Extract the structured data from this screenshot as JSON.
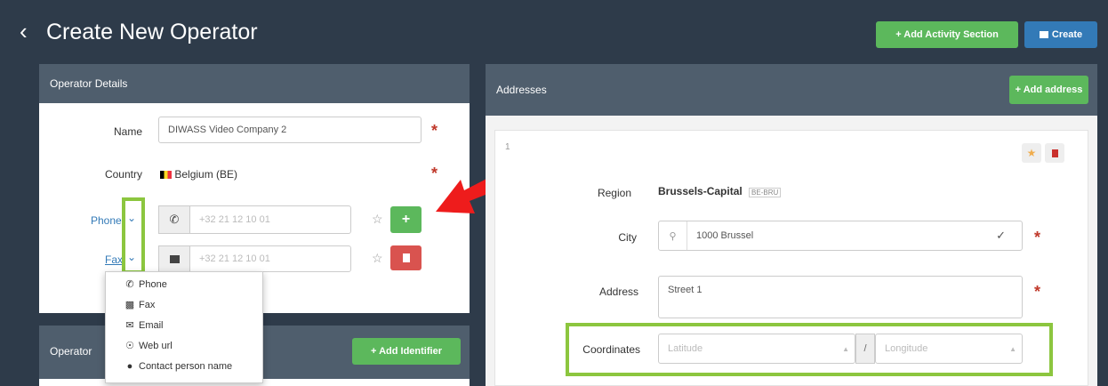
{
  "header": {
    "title": "Create New Operator",
    "add_activity_label": "+ Add Activity Section",
    "create_label": "Create"
  },
  "operator_details": {
    "heading": "Operator Details",
    "name_label": "Name",
    "name_value": "DIWASS Video Company 2",
    "country_label": "Country",
    "country_value": "Belgium (BE)",
    "phone_label": "Phone",
    "phone_placeholder": "+32 21 12 10 01",
    "fax_label": "Fax",
    "fax_placeholder": "+32 21 12 10 01",
    "required_mark": "*"
  },
  "contact_type_menu": {
    "items": [
      {
        "icon": "phone-icon",
        "label": "Phone"
      },
      {
        "icon": "fax-icon",
        "label": "Fax"
      },
      {
        "icon": "envelope-icon",
        "label": "Email"
      },
      {
        "icon": "globe-icon",
        "label": "Web url"
      },
      {
        "icon": "user-icon",
        "label": "Contact person name"
      }
    ]
  },
  "identifiers": {
    "heading": "Operator",
    "add_identifier_label": "+ Add Identifier"
  },
  "addresses": {
    "heading": "Addresses",
    "add_address_label": "+ Add address",
    "index": "1",
    "region_label": "Region",
    "region_value": "Brussels-Capital",
    "region_code": "BE-BRU",
    "city_label": "City",
    "city_value": "1000 Brussel",
    "address_label": "Address",
    "address_value": "Street 1",
    "coordinates_label": "Coordinates",
    "latitude_placeholder": "Latitude",
    "longitude_placeholder": "Longitude",
    "separator": "/"
  },
  "colors": {
    "background": "#2e3b4a",
    "panel_header": "#4f5e6d",
    "success": "#5cb85c",
    "primary": "#337ab7",
    "danger": "#d9534f",
    "highlight": "#8cc63f",
    "arrow": "#ee1c1c"
  }
}
